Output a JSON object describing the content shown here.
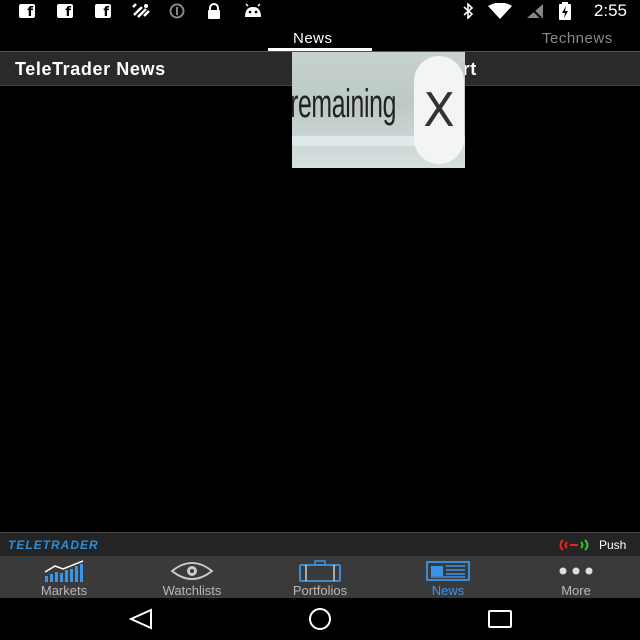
{
  "status_bar": {
    "time": "2:55",
    "icons": [
      "facebook-icon",
      "facebook-icon",
      "facebook-icon",
      "satellite-icon",
      "info-icon",
      "lock-icon",
      "android-icon",
      "bluetooth-icon",
      "wifi-icon",
      "no-signal-icon",
      "battery-charging-icon"
    ]
  },
  "tabs": [
    {
      "label": "News",
      "active": true
    },
    {
      "label": "Technews",
      "active": false
    }
  ],
  "header": {
    "title": "TeleTrader News",
    "partial_title": "art"
  },
  "ad": {
    "text": "remaining",
    "close_label": "X"
  },
  "brand_bar": {
    "logo": "TELETRADER",
    "push_label": "Push",
    "push_colors": {
      "red": "#e22222",
      "green": "#33cc33"
    }
  },
  "bottom_nav": {
    "items": [
      {
        "label": "Markets",
        "icon": "chart-icon",
        "active": false
      },
      {
        "label": "Watchlists",
        "icon": "eye-icon",
        "active": false
      },
      {
        "label": "Portfolios",
        "icon": "briefcase-icon",
        "active": false
      },
      {
        "label": "News",
        "icon": "newspaper-icon",
        "active": true
      },
      {
        "label": "More",
        "icon": "more-dots-icon",
        "active": false
      }
    ],
    "active_color": "#3b95e6"
  },
  "android_nav": [
    "back-icon",
    "home-icon",
    "recents-icon"
  ]
}
